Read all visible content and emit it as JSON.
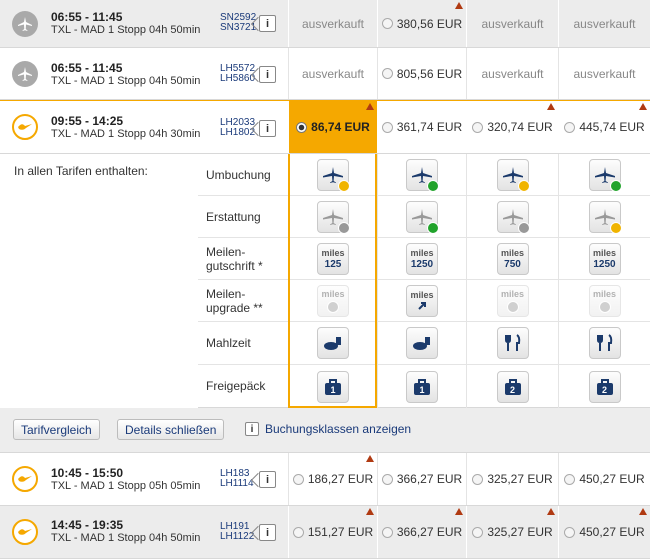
{
  "flights": [
    {
      "times": "06:55 - 11:45",
      "route": "TXL - MAD  1 Stopp  04h 50min",
      "flight_numbers": [
        "SN2592",
        "SN3721"
      ],
      "info_label": "i",
      "prices": [
        "ausverkauft",
        "380,56 EUR",
        "ausverkauft",
        "ausverkauft"
      ],
      "airline_icon": "grey-plane-icon"
    },
    {
      "times": "06:55 - 11:45",
      "route": "TXL - MAD  1 Stopp  04h 50min",
      "flight_numbers": [
        "LH5572",
        "LH5860"
      ],
      "info_label": "i",
      "prices": [
        "ausverkauft",
        "805,56 EUR",
        "ausverkauft",
        "ausverkauft"
      ],
      "airline_icon": "grey-plane-icon"
    },
    {
      "times": "09:55 - 14:25",
      "route": "TXL - MAD  1 Stopp  04h 30min",
      "flight_numbers": [
        "LH2033",
        "LH1802"
      ],
      "info_label": "i",
      "prices": [
        "86,74 EUR",
        "361,74 EUR",
        "320,74 EUR",
        "445,74 EUR"
      ],
      "airline_icon": "lufthansa-crane-icon"
    },
    {
      "times": "10:45 - 15:50",
      "route": "TXL - MAD  1 Stopp  05h 05min",
      "flight_numbers": [
        "LH183",
        "LH1114"
      ],
      "info_label": "i",
      "prices": [
        "186,27 EUR",
        "366,27 EUR",
        "325,27 EUR",
        "450,27 EUR"
      ],
      "airline_icon": "lufthansa-crane-icon"
    },
    {
      "times": "14:45 - 19:35",
      "route": "TXL - MAD  1 Stopp  04h 50min",
      "flight_numbers": [
        "LH191",
        "LH1122"
      ],
      "info_label": "i",
      "prices": [
        "151,27 EUR",
        "366,27 EUR",
        "325,27 EUR",
        "450,27 EUR"
      ],
      "airline_icon": "lufthansa-crane-icon"
    }
  ],
  "features": {
    "included_title": "In allen Tarifen enthalten:",
    "rows": [
      {
        "label": "Umbuchung",
        "icons": [
          "plane-fee-icon",
          "plane-included-icon",
          "plane-fee-icon",
          "plane-included-icon"
        ]
      },
      {
        "label": "Erstattung",
        "icons": [
          "plane-not-included-icon",
          "plane-included-icon",
          "plane-not-included-icon",
          "plane-fee-icon"
        ]
      },
      {
        "label": "Meilen-\ngutschrift *",
        "miles_word": "miles",
        "values": [
          "125",
          "1250",
          "750",
          "1250"
        ]
      },
      {
        "label": "Meilen-\nupgrade **",
        "miles_word": "miles",
        "icons": [
          "miles-not-included-icon",
          "miles-upgrade-icon",
          "miles-not-included-icon",
          "miles-not-included-icon"
        ]
      },
      {
        "label": "Mahlzeit",
        "icons": [
          "snack-icon",
          "snack-icon",
          "meal-icon",
          "meal-icon"
        ]
      },
      {
        "label": "Freigepäck",
        "baggage": [
          "1",
          "1",
          "2",
          "2"
        ]
      }
    ]
  },
  "actions": {
    "compare_label": "Tarifvergleich",
    "close_details_label": "Details schließen",
    "info_label": "i",
    "booking_classes_label": "Buchungsklassen anzeigen"
  },
  "colors": {
    "selected": "#f5a800",
    "included": "#21a32b",
    "fee": "#f0b400",
    "brand_blue": "#1b3a6b"
  }
}
